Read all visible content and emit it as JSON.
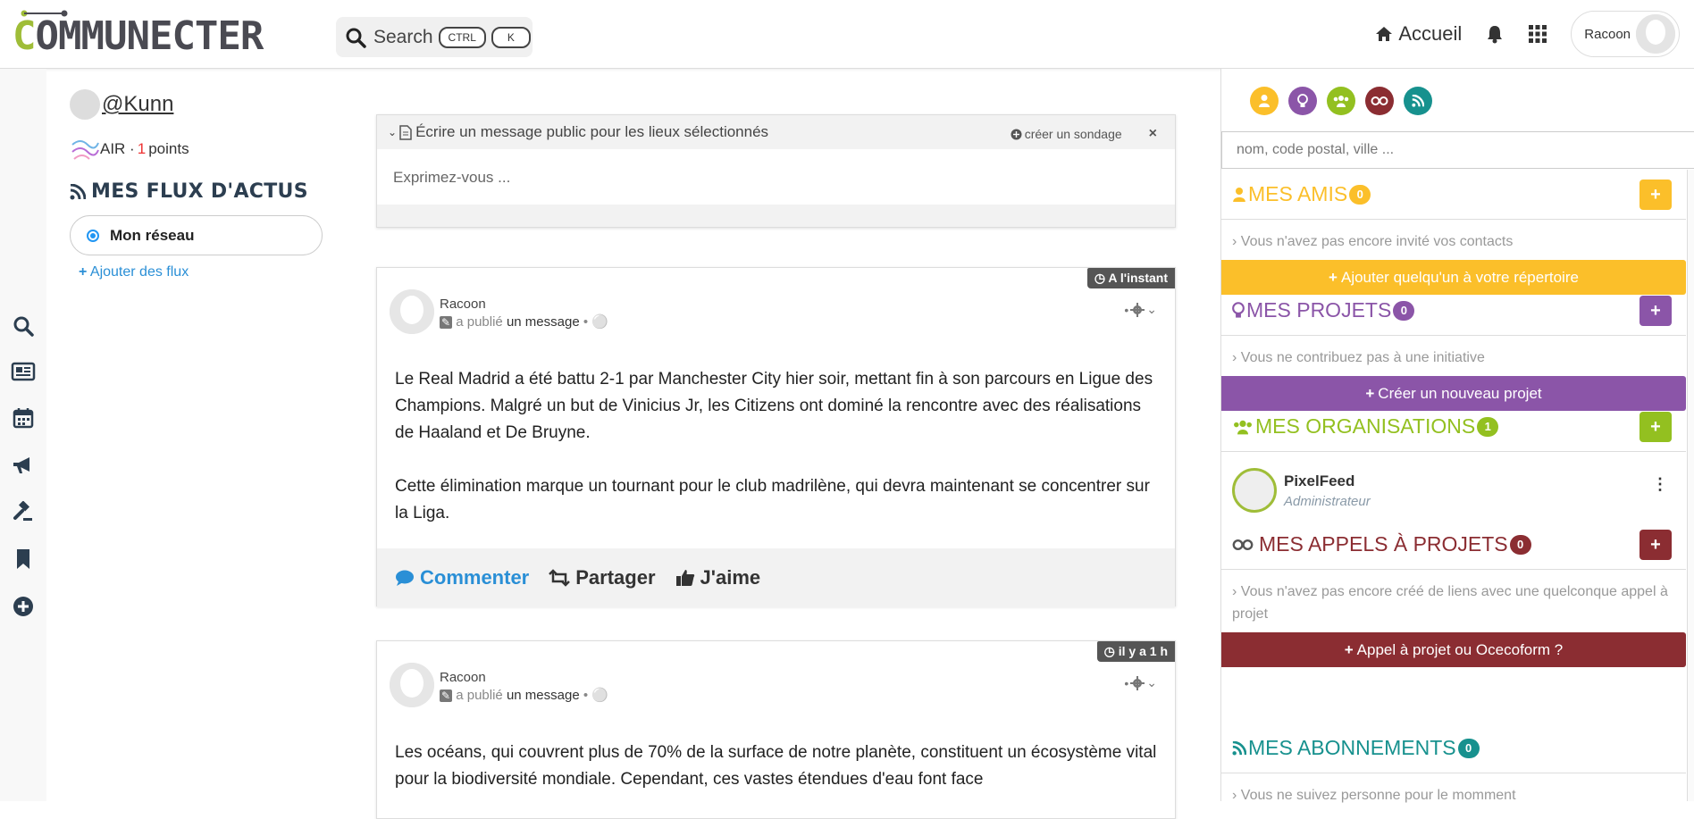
{
  "header": {
    "logo_text": "COMMUNECTER",
    "search_label": "Search",
    "kbd_ctrl": "CTRL",
    "kbd_k": "K",
    "home_label": "Accueil",
    "user_name": "Racoon"
  },
  "left": {
    "handle": "@Kunn",
    "air_label": "AIR ·",
    "points_value": "1",
    "points_label": "points",
    "flux_title": "MES FLUX D'ACTUS",
    "network_option": "Mon réseau",
    "add_flux": "Ajouter des flux"
  },
  "composer": {
    "title": "Écrire un message public pour les lieux sélectionnés",
    "poll_label": "créer un sondage",
    "close": "×",
    "placeholder": "Exprimez-vous ..."
  },
  "posts": [
    {
      "timestamp": "A l'instant",
      "author": "Racoon",
      "meta_prefix": "a publié",
      "meta_type": "un message",
      "paragraphs": [
        "Le Real Madrid a été battu 2-1 par Manchester City hier soir, mettant fin à son parcours en Ligue des Champions. Malgré un but de Vinicius Jr, les Citizens ont dominé la rencontre avec des réalisations de Haaland et De Bruyne.",
        "Cette élimination marque un tournant pour le club madrilène, qui devra maintenant se concentrer sur la Liga."
      ],
      "comment": "Commenter",
      "share": "Partager",
      "like": "J'aime"
    },
    {
      "timestamp": "il y a 1 h",
      "author": "Racoon",
      "meta_prefix": "a publié",
      "meta_type": "un message",
      "paragraphs": [
        "Les océans, qui couvrent plus de 70% de la surface de notre planète, constituent un écosystème vital pour la biodiversité mondiale. Cependant, ces vastes étendues d'eau font face"
      ]
    }
  ],
  "right": {
    "search_placeholder": "nom, code postal, ville ...",
    "friends": {
      "title": "MES AMIS",
      "count": "0",
      "info": "Vous n'avez pas encore invité vos contacts",
      "cta": "Ajouter quelqu'un à votre répertoire",
      "color": "#fbbf2a"
    },
    "projects": {
      "title": "MES PROJETS",
      "count": "0",
      "info": "Vous ne contribuez pas à une initiative",
      "cta": "Créer un nouveau projet",
      "color": "#8b55a8"
    },
    "orgs": {
      "title": "MES ORGANISATIONS",
      "count": "1",
      "org_name": "PixelFeed",
      "org_role": "Administrateur",
      "color": "#93c020"
    },
    "calls": {
      "title": "MES APPELS À PROJETS",
      "count": "0",
      "info": "Vous n'avez pas encore créé de liens avec une quelconque appel à projet",
      "cta": "Appel à projet ou Ocecoform ?",
      "color": "#8b2d32"
    },
    "subs": {
      "title": "MES ABONNEMENTS",
      "count": "0",
      "info": "Vous ne suivez personne pour le momment",
      "color": "#17918e"
    }
  }
}
